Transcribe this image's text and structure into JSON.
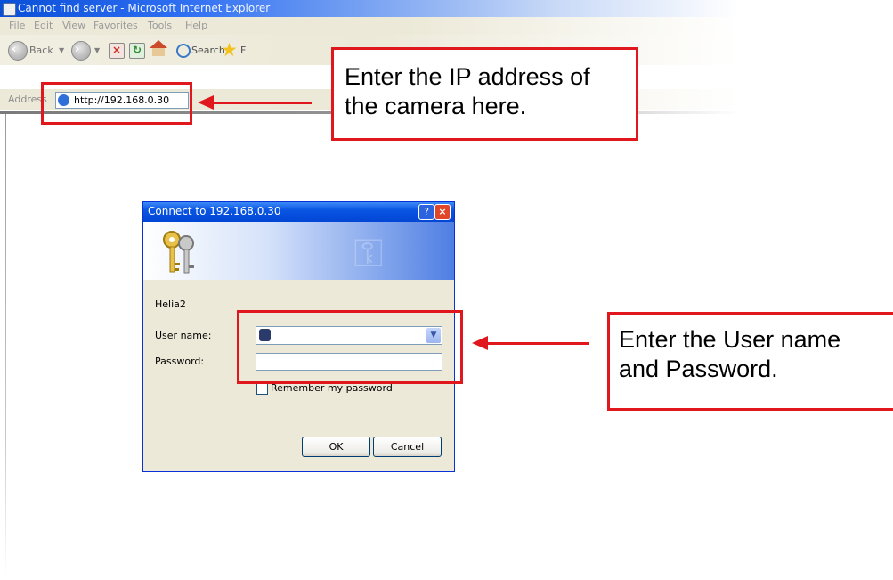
{
  "window": {
    "title": "Cannot find server - Microsoft Internet Explorer",
    "menu": [
      "File",
      "Edit",
      "View",
      "Favorites",
      "Tools",
      "Help"
    ],
    "toolbar": {
      "back": "Back",
      "search": "Search",
      "favorites_partial": "F"
    },
    "address_label": "Address",
    "address_value": "http://192.168.0.30"
  },
  "dialog": {
    "title": "Connect to 192.168.0.30",
    "help_icon": "question-icon",
    "close_icon": "close-icon",
    "server_name": "Helia2",
    "username_label": "User name:",
    "password_label": "Password:",
    "remember_label": "Remember my password",
    "ok_label": "OK",
    "cancel_label": "Cancel"
  },
  "annotations": {
    "callout_ip": "Enter the IP address of the camera here.",
    "callout_ip_lines": [
      "Enter the IP address of",
      "the camera here."
    ],
    "callout_login_lines": [
      "Enter the User name",
      "and Password."
    ],
    "accent_color": "#e0181e"
  }
}
